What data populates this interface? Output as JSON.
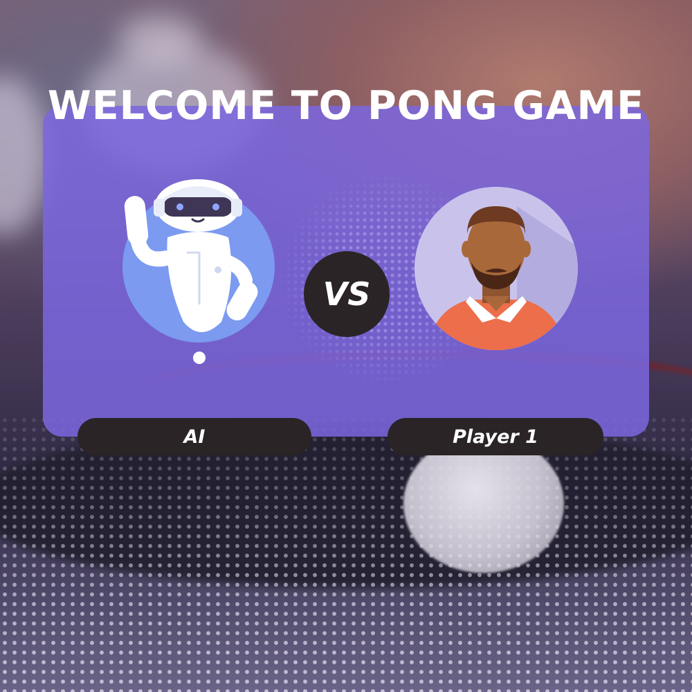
{
  "title": "WELCOME TO PONG GAME",
  "versus_label": "VS",
  "players": [
    {
      "label": "AI",
      "avatar": "robot-icon",
      "avatar_bg": "#7b9af0"
    },
    {
      "label": "Player 1",
      "avatar": "person-icon",
      "avatar_bg": "#c9c3ec",
      "shirt": "#ec6e4a",
      "skin": "#a8683a"
    }
  ],
  "colors": {
    "card": "#7c66de",
    "pill": "#2a2426",
    "text": "#ffffff"
  }
}
